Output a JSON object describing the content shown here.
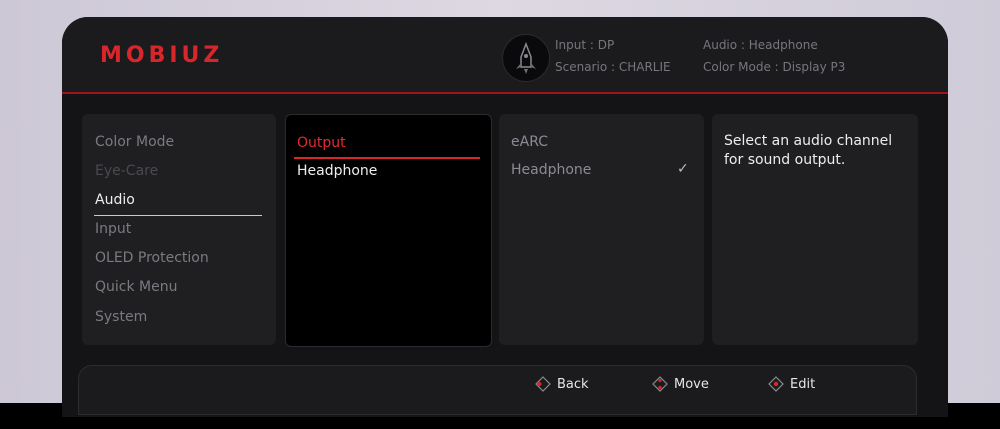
{
  "brand": {
    "logo": "MOBIUZ"
  },
  "header": {
    "input_label": "Input : DP",
    "scenario_label": "Scenario : CHARLIE",
    "audio_label": "Audio : Headphone",
    "color_mode_label": "Color Mode : Display P3"
  },
  "menu": {
    "items": [
      {
        "label": "Color Mode"
      },
      {
        "label": "Eye-Care"
      },
      {
        "label": "Audio"
      },
      {
        "label": "Input"
      },
      {
        "label": "OLED Protection"
      },
      {
        "label": "Quick Menu"
      },
      {
        "label": "System"
      }
    ]
  },
  "submenu": {
    "header": "Output",
    "item": "Headphone"
  },
  "options": {
    "items": [
      {
        "label": "eARC"
      },
      {
        "label": "Headphone"
      }
    ],
    "check": "✓"
  },
  "description": {
    "text": "Select an audio channel for sound output."
  },
  "footer": {
    "back": "Back",
    "move": "Move",
    "edit": "Edit"
  },
  "colors": {
    "accent": "#d8262b",
    "panel": "#1f1f22",
    "background": "#141417"
  }
}
